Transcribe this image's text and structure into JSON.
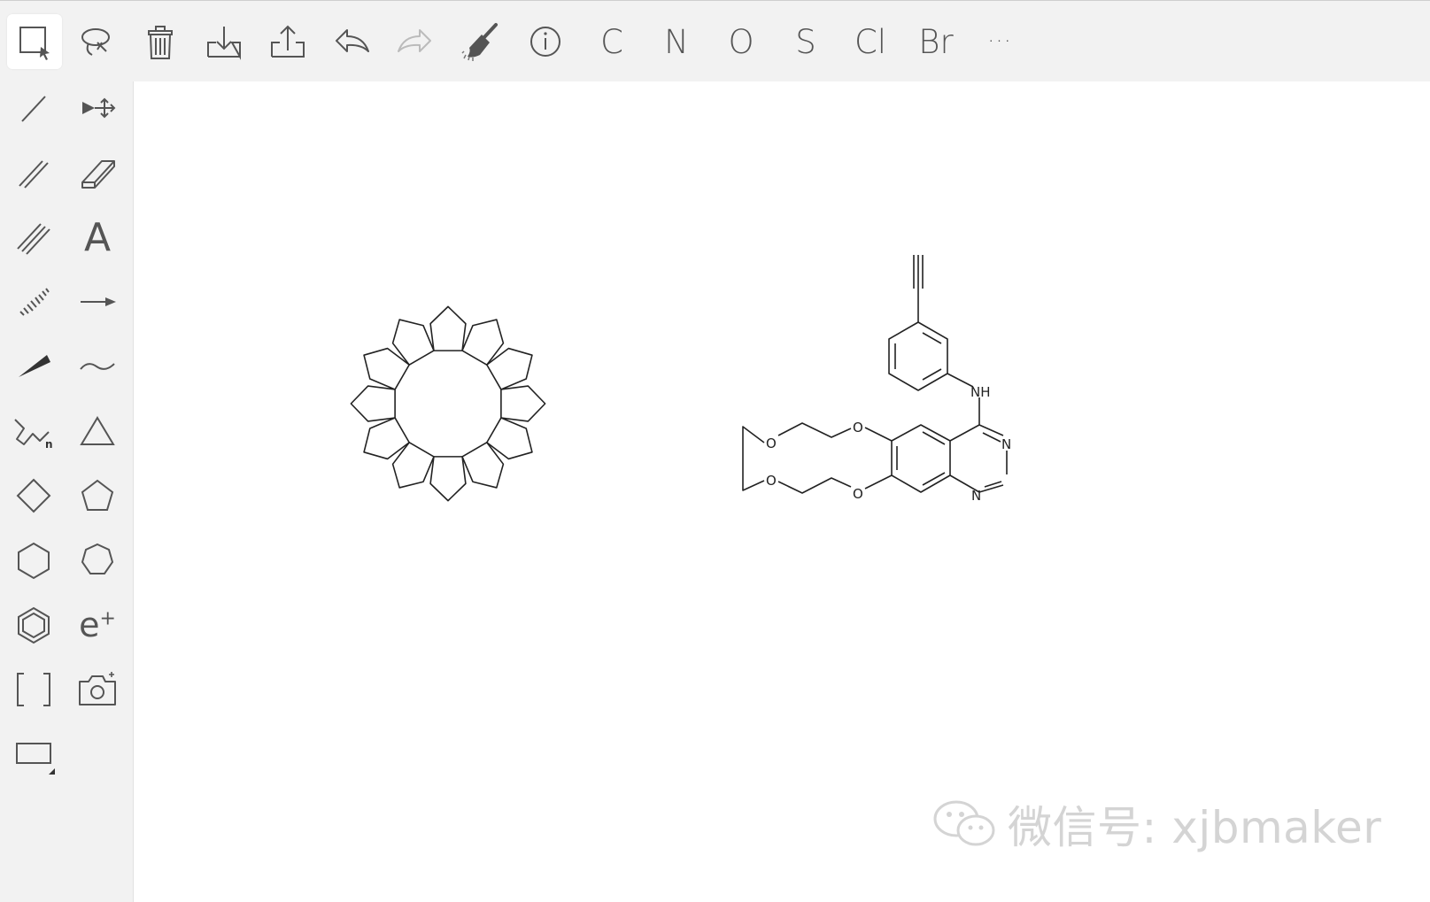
{
  "toolbar": {
    "tools": [
      "select-icon",
      "lasso-icon",
      "trash-icon",
      "import-icon",
      "export-icon",
      "undo-icon",
      "redo-icon",
      "clean-broom-icon",
      "info-icon"
    ],
    "elements": [
      "C",
      "N",
      "O",
      "S",
      "Cl",
      "Br"
    ],
    "more_label": "···"
  },
  "sidebar": {
    "text_tool_label": "A",
    "electron_label": "e",
    "electron_sup": "+",
    "chain_label": "n",
    "bracket_label": "[  ]"
  },
  "canvas": {
    "molecule2": {
      "labels": {
        "nh": "NH",
        "n1": "N",
        "n2": "N",
        "o1": "O",
        "o2": "O",
        "o3": "O",
        "o4": "O"
      }
    }
  },
  "watermark": {
    "text": "微信号: xjbmaker"
  },
  "colors": {
    "toolbar_bg": "#f2f2f2",
    "canvas_bg": "#ffffff",
    "icon": "#555555",
    "watermark": "#d4d4d4"
  }
}
